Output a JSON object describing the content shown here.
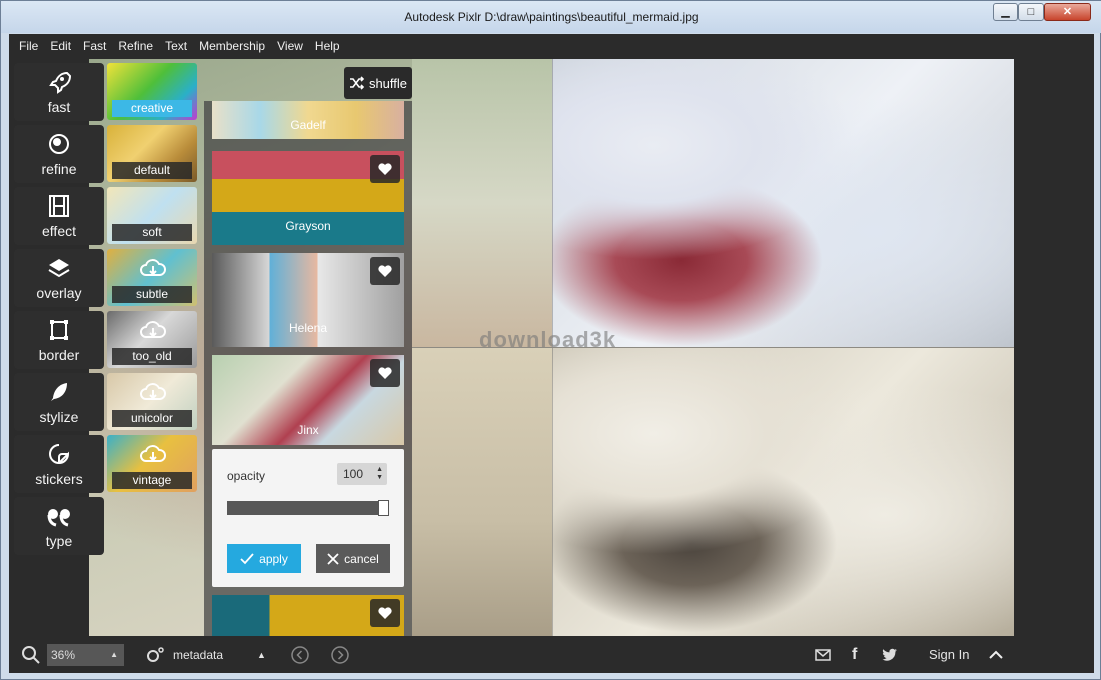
{
  "window": {
    "title": "Autodesk Pixlr    D:\\draw\\paintings\\beautiful_mermaid.jpg",
    "minimize": "▁",
    "maximize": "□",
    "close": "✕"
  },
  "menu": [
    "File",
    "Edit",
    "Fast",
    "Refine",
    "Text",
    "Membership",
    "View",
    "Help"
  ],
  "tools": [
    {
      "label": "fast",
      "icon": "rocket-icon"
    },
    {
      "label": "refine",
      "icon": "refine-icon"
    },
    {
      "label": "effect",
      "icon": "film-icon"
    },
    {
      "label": "overlay",
      "icon": "layers-icon"
    },
    {
      "label": "border",
      "icon": "border-icon"
    },
    {
      "label": "stylize",
      "icon": "feather-icon"
    },
    {
      "label": "stickers",
      "icon": "sticker-icon"
    },
    {
      "label": "type",
      "icon": "quote-icon"
    }
  ],
  "presets": [
    {
      "label": "creative",
      "active": true
    },
    {
      "label": "default",
      "active": false
    },
    {
      "label": "soft",
      "active": false
    },
    {
      "label": "subtle",
      "active": false
    },
    {
      "label": "too_old",
      "active": false
    },
    {
      "label": "unicolor",
      "active": false
    },
    {
      "label": "vintage",
      "active": false
    }
  ],
  "filters": {
    "shuffle": "shuffle",
    "items": [
      "Gadelf",
      "Grayson",
      "Helena",
      "Jinx"
    ]
  },
  "opacity": {
    "label": "opacity",
    "value": "100",
    "fraction": 1.0,
    "apply": "apply",
    "cancel": "cancel"
  },
  "status": {
    "zoom": "36%",
    "metadata": "metadata",
    "sign_in": "Sign In"
  },
  "watermark": "download3k",
  "colors": {
    "accent": "#25a9df",
    "panel": "#2b2b2b"
  }
}
